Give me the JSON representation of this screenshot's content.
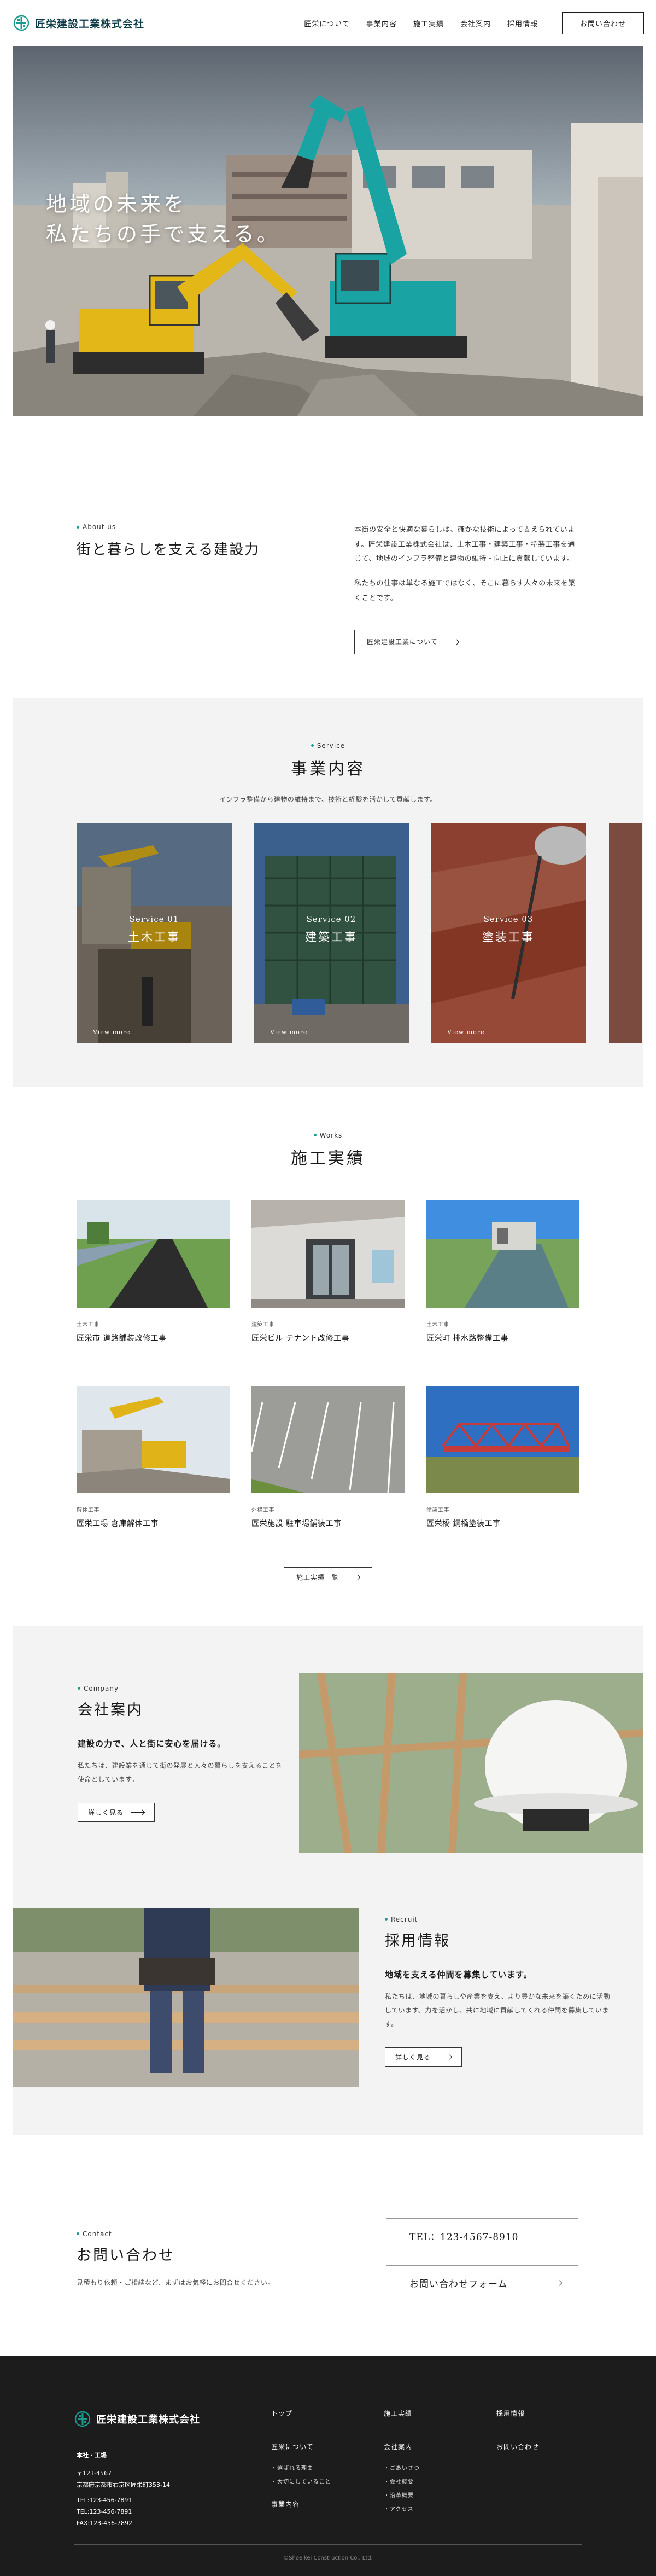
{
  "header": {
    "logo_text": "匠栄建設工業株式会社",
    "nav": [
      "匠栄について",
      "事業内容",
      "施工実績",
      "会社案内",
      "採用情報"
    ],
    "cta": "お問い合わせ"
  },
  "hero": {
    "line1": "地域の未来を",
    "line2": "私たちの手で支える。"
  },
  "about": {
    "eyebrow": "About us",
    "title": "街と暮らしを支える建設力",
    "para1": "本街の安全と快適な暮らしは、確かな技術によって支えられています。匠栄建設工業株式会社は、土木工事・建築工事・塗装工事を通じて、地域のインフラ整備と建物の維持・向上に貢献しています。",
    "para2": "私たちの仕事は単なる施工ではなく、そこに暮らす人々の未来を築くことです。",
    "button": "匠栄建設工業について"
  },
  "service": {
    "eyebrow": "Service",
    "title": "事業内容",
    "subtitle": "インフラ整備から建物の維持まで、技術と経験を活かして貢献します。",
    "cards": [
      {
        "num": "Service 01",
        "title": "土木工事",
        "more": "View more"
      },
      {
        "num": "Service 02",
        "title": "建築工事",
        "more": "View more"
      },
      {
        "num": "Service 03",
        "title": "塗装工事",
        "more": "View more"
      }
    ]
  },
  "works": {
    "eyebrow": "Works",
    "title": "施工実績",
    "items": [
      {
        "category": "土木工事",
        "title": "匠栄市 道路舗装改修工事"
      },
      {
        "category": "建築工事",
        "title": "匠栄ビル テナント改修工事"
      },
      {
        "category": "土木工事",
        "title": "匠栄町 排水路整備工事"
      },
      {
        "category": "解体工事",
        "title": "匠栄工場 倉庫解体工事"
      },
      {
        "category": "外構工事",
        "title": "匠栄施設 駐車場舗装工事"
      },
      {
        "category": "塗装工事",
        "title": "匠栄橋 鋼橋塗装工事"
      }
    ],
    "button": "施工実績一覧"
  },
  "company": {
    "eyebrow": "Company",
    "title": "会社案内",
    "lead": "建設の力で、人と街に安心を届ける。",
    "body": "私たちは、建設業を通じて街の発展と人々の暮らしを支えることを使命としています。",
    "button": "詳しく見る"
  },
  "recruit": {
    "eyebrow": "Recruit",
    "title": "採用情報",
    "lead": "地域を支える仲間を募集しています。",
    "body": "私たちは、地域の暮らしや産業を支え、より豊かな未来を築くために活動しています。力を活かし、共に地域に貢献してくれる仲間を募集しています。",
    "button": "詳しく見る"
  },
  "contact": {
    "eyebrow": "Contact",
    "title": "お問い合わせ",
    "subtitle": "見積もり依頼・ご相談など、まずはお気軽にお問合せください。",
    "tel": "TEL：123-4567-8910",
    "form": "お問い合わせフォーム"
  },
  "footer": {
    "logo_text": "匠栄建設工業株式会社",
    "address_label": "本社・工場",
    "zip": "〒123-4567",
    "address": "京都府京都市右京区匠栄町353-14",
    "tel1": "TEL:123-456-7891",
    "tel2": "TEL:123-456-7891",
    "fax": "FAX:123-456-7892",
    "col1": {
      "top": "トップ",
      "about": "匠栄について",
      "sub1": "・選ばれる理由",
      "sub2": "・大切にしていること",
      "service": "事業内容"
    },
    "col2": {
      "works": "施工実績",
      "company": "会社案内",
      "sub1": "・ごあいさつ",
      "sub2": "・会社概要",
      "sub3": "・沿革概要",
      "sub4": "・アクセス"
    },
    "col3": {
      "recruit": "採用情報",
      "contact": "お問い合わせ"
    },
    "copyright": "©Shoeikei Construction Co., Ltd."
  }
}
